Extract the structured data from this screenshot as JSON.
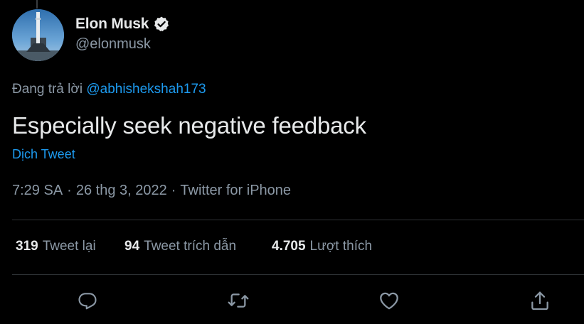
{
  "author": {
    "display_name": "Elon Musk",
    "handle": "@elonmusk",
    "verified": true,
    "avatar": "avatar-rocket-launchpad"
  },
  "reply": {
    "prefix": "Đang trả lời",
    "mention": "@abhishekshah173"
  },
  "tweet": {
    "text": "Especially seek negative feedback",
    "translate_label": "Dịch Tweet"
  },
  "meta": {
    "time": "7:29 SA",
    "date": "26 thg 3, 2022",
    "source": "Twitter for iPhone",
    "separator": "·"
  },
  "stats": {
    "retweets": {
      "count": "319",
      "label": "Tweet lại"
    },
    "quotes": {
      "count": "94",
      "label": "Tweet trích dẫn"
    },
    "likes": {
      "count": "4.705",
      "label": "Lượt thích"
    }
  },
  "actions": [
    {
      "icon": "reply-icon"
    },
    {
      "icon": "retweet-icon"
    },
    {
      "icon": "like-icon"
    },
    {
      "icon": "share-icon"
    }
  ],
  "colors": {
    "background": "#000000",
    "text_primary": "#e7e9ea",
    "text_secondary": "#8b98a5",
    "link": "#1d9bf0",
    "divider": "#2f3336"
  }
}
